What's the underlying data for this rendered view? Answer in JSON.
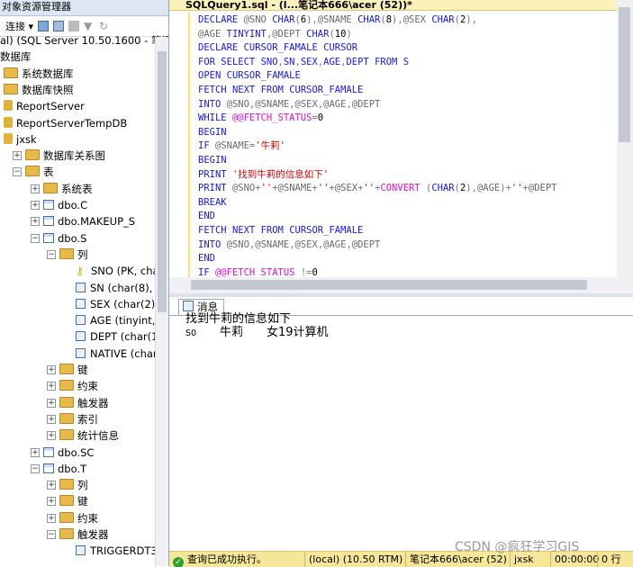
{
  "object_explorer": {
    "title": "对象资源管理器",
    "toolbar_connect": "连接",
    "tree": [
      {
        "label": "al) (SQL Server 10.50.1600 - 笔记",
        "icon": "none"
      },
      {
        "label": "数据库",
        "icon": "none"
      },
      {
        "label": "系统数据库",
        "icon": "folder"
      },
      {
        "label": "数据库快照",
        "icon": "folder"
      },
      {
        "label": "ReportServer",
        "icon": "database"
      },
      {
        "label": "ReportServerTempDB",
        "icon": "database"
      },
      {
        "label": "jxsk",
        "icon": "database"
      },
      {
        "label": "数据库关系图",
        "icon": "folder"
      },
      {
        "label": "表",
        "icon": "folder"
      },
      {
        "label": "系统表",
        "icon": "folder"
      },
      {
        "label": "dbo.C",
        "icon": "table"
      },
      {
        "label": "dbo.MAKEUP_S",
        "icon": "table"
      },
      {
        "label": "dbo.S",
        "icon": "table"
      },
      {
        "label": "列",
        "icon": "folder"
      },
      {
        "label": "SNO (PK, char(2",
        "icon": "key"
      },
      {
        "label": "SN (char(8), not",
        "icon": "column"
      },
      {
        "label": "SEX (char(2), nu",
        "icon": "column"
      },
      {
        "label": "AGE (tinyint, nul",
        "icon": "column"
      },
      {
        "label": "DEPT (char(10),",
        "icon": "column"
      },
      {
        "label": "NATIVE (char(10",
        "icon": "column"
      },
      {
        "label": "键",
        "icon": "folder"
      },
      {
        "label": "约束",
        "icon": "folder"
      },
      {
        "label": "触发器",
        "icon": "folder"
      },
      {
        "label": "索引",
        "icon": "folder"
      },
      {
        "label": "统计信息",
        "icon": "folder"
      },
      {
        "label": "dbo.SC",
        "icon": "table"
      },
      {
        "label": "dbo.T",
        "icon": "table"
      },
      {
        "label": "列",
        "icon": "folder"
      },
      {
        "label": "键",
        "icon": "folder"
      },
      {
        "label": "约束",
        "icon": "folder"
      },
      {
        "label": "触发器",
        "icon": "folder"
      },
      {
        "label": "TRIGGERDT3",
        "icon": "column"
      }
    ]
  },
  "editor": {
    "tab_title": "SQLQuery1.sql - (l...笔记本666\\acer (52))*",
    "close_label": "×",
    "lines": [
      "DECLARE @SNO CHAR(6),@SNAME CHAR(8),@SEX CHAR(2),",
      "@AGE TINYINT,@DEPT CHAR(10)",
      "DECLARE CURSOR_FAMALE CURSOR",
      "FOR SELECT SNO,SN,SEX,AGE,DEPT FROM S",
      "OPEN CURSOR_FAMALE",
      "FETCH NEXT FROM CURSOR_FAMALE",
      "INTO @SNO,@SNAME,@SEX,@AGE,@DEPT",
      "WHILE @@FETCH_STATUS=0",
      "BEGIN",
      "IF @SNAME='牛莉'",
      "BEGIN",
      "PRINT '找到牛莉的信息如下'",
      "PRINT @SNO+''+@SNAME+''+@SEX+''+CONVERT (CHAR(2),@AGE)+''+@DEPT",
      "BREAK",
      "END",
      "FETCH NEXT FROM CURSOR_FAMALE",
      "INTO @SNO,@SNAME,@SEX,@AGE,@DEPT",
      "END",
      "IF @@FETCH_STATUS !=0"
    ]
  },
  "results": {
    "tab_label": "消息",
    "message1": "找到牛莉的信息如下",
    "message2_sno": "S0",
    "message2_name": "牛莉",
    "message2_rest": "女19计算机"
  },
  "status": {
    "state": "查询已成功执行。",
    "server": "(local) (10.50 RTM)",
    "user": "笔记本666\\acer (52)",
    "db": "jxsk",
    "time": "00:00:00",
    "rows": "0 行"
  },
  "watermark": "CSDN @疯狂学习GIS",
  "colors": {
    "keyword": "#1616ff",
    "string": "#e00000",
    "status_bar": "#f5e79a",
    "tab": "#fbf1ba"
  }
}
